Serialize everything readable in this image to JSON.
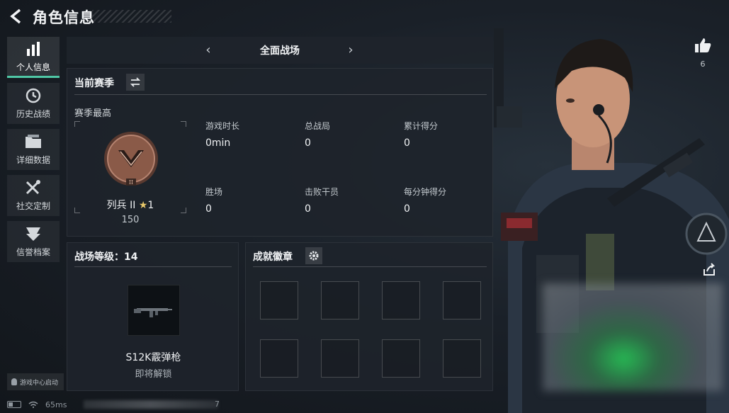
{
  "header": {
    "title": "角色信息"
  },
  "sidebar": {
    "items": [
      {
        "label": "个人信息",
        "icon": "bar-chart-icon",
        "active": true
      },
      {
        "label": "历史战绩",
        "icon": "history-clock-icon",
        "active": false
      },
      {
        "label": "详细数据",
        "icon": "folder-icon",
        "active": false
      },
      {
        "label": "社交定制",
        "icon": "tools-icon",
        "active": false
      },
      {
        "label": "信誉档案",
        "icon": "shield-badge-icon",
        "active": false
      }
    ],
    "game_center_label": "游戏中心启动"
  },
  "status": {
    "ping": "65ms",
    "strip_number": "7"
  },
  "mode": {
    "title": "全面战场"
  },
  "season": {
    "heading": "当前赛季",
    "best_label": "赛季最高",
    "rank_name": "列兵 II",
    "rank_stars": "1",
    "rank_score": "150",
    "stats": [
      {
        "label": "游戏时长",
        "value": "0min"
      },
      {
        "label": "总战局",
        "value": "0"
      },
      {
        "label": "累计得分",
        "value": "0"
      },
      {
        "label": "胜场",
        "value": "0"
      },
      {
        "label": "击败干员",
        "value": "0"
      },
      {
        "label": "每分钟得分",
        "value": "0"
      }
    ]
  },
  "battle_level": {
    "title": "战场等级：14",
    "weapon_name": "S12K霰弹枪",
    "weapon_status": "即将解锁"
  },
  "achievements": {
    "title": "成就徽章",
    "slots": 8
  },
  "profile": {
    "likes": "6"
  },
  "colors": {
    "accent": "#4fc7a5",
    "rank_bronze": "#8a5a48",
    "star": "#e8c86a"
  }
}
